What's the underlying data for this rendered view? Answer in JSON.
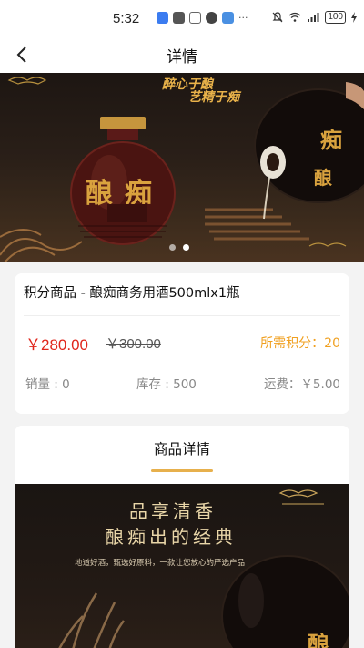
{
  "status_bar": {
    "time": "5:32",
    "battery": "100"
  },
  "nav": {
    "title": "详情"
  },
  "banner": {
    "slogan_line1": "醉心于酿",
    "slogan_line2": "艺精于痴",
    "bottle_brand": "酿痴",
    "slide_count": 2,
    "active_slide": 1
  },
  "product": {
    "name": "积分商品 - 酿痴商务用酒500mlx1瓶",
    "price": "￥280.00",
    "original_price": "￥300.00",
    "points": "所需积分：20",
    "sales": "销量 : 0",
    "stock": "库存 : 500",
    "freight": "运费：￥5.00"
  },
  "detail": {
    "title": "商品详情",
    "image_heading_1": "品享清香",
    "image_heading_2": "酿痴出的经典",
    "image_subtitle": "地道好酒，甄选好原料，一款让您放心的严选产品",
    "image_brand": "酿"
  },
  "colors": {
    "price_red": "#e0261c",
    "points_orange": "#f0a020",
    "gold_accent": "#e7b04c"
  }
}
